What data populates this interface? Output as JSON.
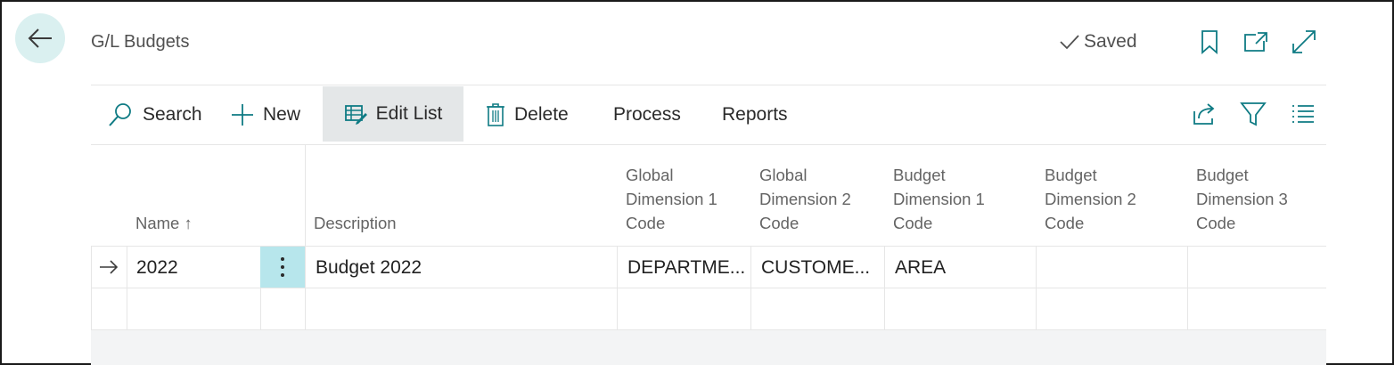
{
  "header": {
    "title": "G/L Budgets",
    "saved_label": "Saved",
    "icons": [
      "back-arrow-icon",
      "bookmark-icon",
      "open-new-window-icon",
      "expand-icon"
    ]
  },
  "toolbar": {
    "search_label": "Search",
    "new_label": "New",
    "edit_list_label": "Edit List",
    "delete_label": "Delete",
    "process_label": "Process",
    "reports_label": "Reports",
    "right_icons": [
      "share-icon",
      "filter-icon",
      "list-view-icon"
    ]
  },
  "table": {
    "columns": {
      "name": "Name",
      "name_sort_indicator": "↑",
      "description": "Description",
      "global_dim1": [
        "Global",
        "Dimension 1",
        "Code"
      ],
      "global_dim2": [
        "Global",
        "Dimension 2",
        "Code"
      ],
      "budget_dim1": [
        "Budget",
        "Dimension 1",
        "Code"
      ],
      "budget_dim2": [
        "Budget",
        "Dimension 2",
        "Code"
      ],
      "budget_dim3": [
        "Budget",
        "Dimension 3",
        "Code"
      ]
    },
    "rows": [
      {
        "name": "2022",
        "description": "Budget 2022",
        "global_dim1": "DEPARTME...",
        "global_dim2": "CUSTOME...",
        "budget_dim1": "AREA",
        "budget_dim2": "",
        "budget_dim3": ""
      }
    ]
  },
  "colors": {
    "accent": "#0f7b84",
    "back_button_bg": "#daf0f0",
    "selected_cell_bg": "#b7e6ec",
    "active_tool_bg": "#e4e7e8"
  }
}
